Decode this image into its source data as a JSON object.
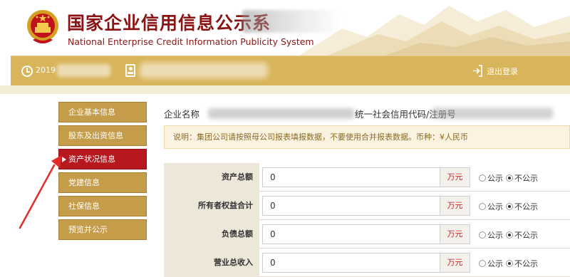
{
  "header": {
    "title_cn": "国家企业信用信息公示系",
    "title_en": "National Enterprise Credit Information Publicity System"
  },
  "bar": {
    "date_prefix": "2019",
    "logout_label": "退出登录"
  },
  "sidebar": {
    "items": [
      {
        "label": "企业基本信息",
        "active": false
      },
      {
        "label": "股东及出资信息",
        "active": false
      },
      {
        "label": "资产状况信息",
        "active": true
      },
      {
        "label": "党建信息",
        "active": false
      },
      {
        "label": "社保信息",
        "active": false
      },
      {
        "label": "预览并公示",
        "active": false
      }
    ]
  },
  "main": {
    "company_label": "企业名称",
    "credit_label": "统一社会信用代码/注册号",
    "notice": "说明：集团公司请按照母公司报表填报数据，不要使用合并报表数据。币种：¥人民币",
    "fields": [
      {
        "label": "资产总额",
        "value": "0",
        "unit": "万元",
        "public_label": "公示",
        "private_label": "不公示",
        "selected": "不公示"
      },
      {
        "label": "所有者权益合计",
        "value": "0",
        "unit": "万元",
        "public_label": "公示",
        "private_label": "不公示",
        "selected": "不公示"
      },
      {
        "label": "负债总额",
        "value": "0",
        "unit": "万元",
        "public_label": "公示",
        "private_label": "不公示",
        "selected": "不公示"
      },
      {
        "label": "营业总收入",
        "value": "0",
        "unit": "万元",
        "public_label": "公示",
        "private_label": "不公示",
        "selected": "不公示"
      }
    ]
  },
  "colors": {
    "brand_red": "#8a1414",
    "bar_gold": "#d8b45a",
    "nav_gold": "#c59c4a",
    "nav_active": "#b7181e"
  }
}
